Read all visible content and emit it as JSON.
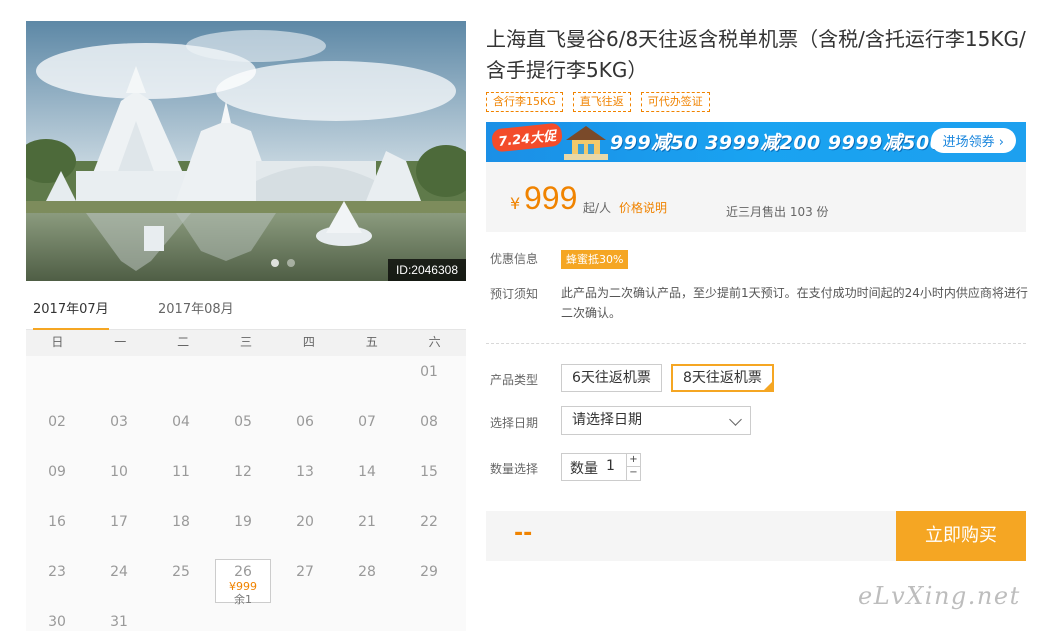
{
  "photo": {
    "id_label": "ID:2046308",
    "slides": 2
  },
  "calendar": {
    "tabs": [
      "2017年07月",
      "2017年08月"
    ],
    "active_tab": 0,
    "weekdays": [
      "日",
      "一",
      "二",
      "三",
      "四",
      "五",
      "六"
    ],
    "days": [
      {
        "d": ""
      },
      {
        "d": ""
      },
      {
        "d": ""
      },
      {
        "d": ""
      },
      {
        "d": ""
      },
      {
        "d": ""
      },
      {
        "d": "01"
      },
      {
        "d": "02"
      },
      {
        "d": "03"
      },
      {
        "d": "04"
      },
      {
        "d": "05"
      },
      {
        "d": "06"
      },
      {
        "d": "07"
      },
      {
        "d": "08"
      },
      {
        "d": "09"
      },
      {
        "d": "10"
      },
      {
        "d": "11"
      },
      {
        "d": "12"
      },
      {
        "d": "13"
      },
      {
        "d": "14"
      },
      {
        "d": "15"
      },
      {
        "d": "16"
      },
      {
        "d": "17"
      },
      {
        "d": "18"
      },
      {
        "d": "19"
      },
      {
        "d": "20"
      },
      {
        "d": "21"
      },
      {
        "d": "22"
      },
      {
        "d": "23"
      },
      {
        "d": "24"
      },
      {
        "d": "25"
      },
      {
        "d": "26",
        "price": "¥999",
        "left": "余1"
      },
      {
        "d": "27"
      },
      {
        "d": "28"
      },
      {
        "d": "29"
      },
      {
        "d": "30"
      },
      {
        "d": "31"
      }
    ]
  },
  "product": {
    "title": "上海直飞曼谷6/8天往返含税单机票（含税/含托运行李15KG/含手提行李5KG）",
    "tags": [
      "含行李15KG",
      "直飞往返",
      "可代办签证"
    ]
  },
  "promo": {
    "badge": "7.24大促",
    "text": "999减50  3999减200  9999减500",
    "button": "进场领券 ›",
    "accent": "#1b8fe6"
  },
  "price": {
    "yen": "¥",
    "amount": "999",
    "per": "起/人",
    "link": "价格说明",
    "sold": "近三月售出 103 份"
  },
  "info": {
    "discount_label": "优惠信息",
    "discount_badge": "蜂蜜抵30%",
    "notice_label": "预订须知",
    "notice_text": "此产品为二次确认产品，至少提前1天预订。在支付成功时间起的24小时内供应商将进行二次确认。"
  },
  "options": {
    "type_label": "产品类型",
    "types": [
      "6天往返机票",
      "8天往返机票"
    ],
    "selected_type": 1,
    "date_label": "选择日期",
    "date_value": "请选择日期",
    "qty_label": "数量选择",
    "qty_inner_label": "数量",
    "qty_value": "1",
    "plus": "+",
    "minus": "−"
  },
  "buy": {
    "total": "--",
    "button": "立即购买"
  },
  "watermark": "eLvXing.net",
  "colors": {
    "orange": "#f08300",
    "button": "#f5a623"
  }
}
